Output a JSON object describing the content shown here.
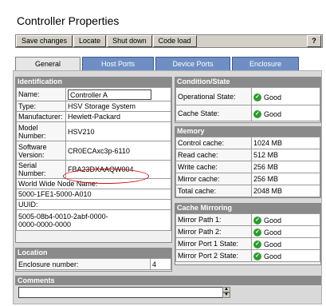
{
  "page": {
    "title": "Controller Properties"
  },
  "toolbar": {
    "save_label": "Save changes",
    "locate_label": "Locate",
    "shutdown_label": "Shut down",
    "codeload_label": "Code load",
    "help_label": "?"
  },
  "tabs": [
    "General",
    "Host Ports",
    "Device Ports",
    "Enclosure"
  ],
  "identification": {
    "header": "Identification",
    "name_label": "Name:",
    "name_value": "Controller A",
    "type_label": "Type:",
    "type_value": "HSV Storage System",
    "manufacturer_label": "Manufacturer:",
    "manufacturer_value": "Hewlett-Packard",
    "model_label": "Model Number:",
    "model_value": "HSV210",
    "software_label": "Software Version:",
    "software_value": "CR0ECAxc3p-6110",
    "serial_label": "Serial Number:",
    "serial_value": "FBA23DXAAQW004",
    "wwn_label": "World Wide Node Name:",
    "wwn_value": "5000-1FE1-5000-A010",
    "uuid_label": "UUID:",
    "uuid_value": "5005-08b4-0010-2abf-0000-0000-0000-0000"
  },
  "location": {
    "header": "Location",
    "enclosure_label": "Enclosure number:",
    "enclosure_value": "4"
  },
  "condition": {
    "header": "Condition/State",
    "operational_label": "Operational State:",
    "operational_value": "Good",
    "cache_label": "Cache State:",
    "cache_value": "Good"
  },
  "memory": {
    "header": "Memory",
    "rows": [
      {
        "label": "Control cache:",
        "value": "1024 MB"
      },
      {
        "label": "Read cache:",
        "value": "512 MB"
      },
      {
        "label": "Write cache:",
        "value": "256 MB"
      },
      {
        "label": "Mirror cache:",
        "value": "256 MB"
      },
      {
        "label": "Total cache:",
        "value": "2048 MB"
      }
    ]
  },
  "mirroring": {
    "header": "Cache Mirroring",
    "rows": [
      {
        "label": "Mirror Path 1:",
        "value": "Good"
      },
      {
        "label": "Mirror Path 2:",
        "value": "Good"
      },
      {
        "label": "Mirror Port 1 State:",
        "value": "Good"
      },
      {
        "label": "Mirror Port 2 State:",
        "value": "Good"
      }
    ]
  },
  "comments": {
    "header": "Comments",
    "value": ""
  },
  "icons": {
    "good": "check-circle-icon",
    "scroll_up": "arrow-up-icon",
    "scroll_down": "arrow-down-icon"
  },
  "colors": {
    "good_green": "#2e9b2e",
    "tab_blue": "#6f8fc4",
    "highlight_red": "#d01010"
  }
}
